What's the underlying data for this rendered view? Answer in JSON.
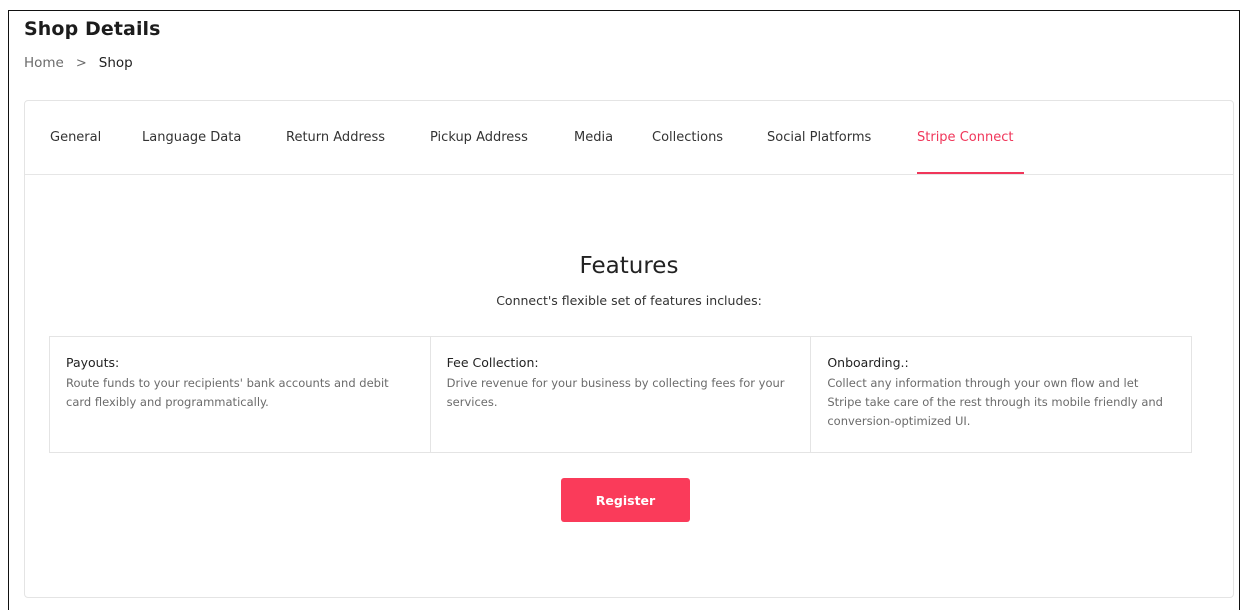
{
  "page": {
    "title": "Shop Details",
    "breadcrumb": {
      "home": "Home",
      "separator": ">",
      "current": "Shop"
    }
  },
  "tabs": [
    {
      "label": "General",
      "active": false
    },
    {
      "label": "Language Data",
      "active": false
    },
    {
      "label": "Return Address",
      "active": false
    },
    {
      "label": "Pickup Address",
      "active": false
    },
    {
      "label": "Media",
      "active": false
    },
    {
      "label": "Collections",
      "active": false
    },
    {
      "label": "Social Platforms",
      "active": false
    },
    {
      "label": "Stripe Connect",
      "active": true
    }
  ],
  "features": {
    "title": "Features",
    "subtitle": "Connect's flexible set of features includes:",
    "items": [
      {
        "title": "Payouts:",
        "description": "Route funds to your recipients' bank accounts and debit card flexibly and programmatically."
      },
      {
        "title": "Fee Collection:",
        "description": "Drive revenue for your business by collecting fees for your services."
      },
      {
        "title": "Onboarding.:",
        "description": "Collect any information through your own flow and let Stripe take care of the rest through its mobile friendly and conversion-optimized UI."
      }
    ]
  },
  "actions": {
    "register_label": "Register"
  },
  "colors": {
    "accent": "#f0365a",
    "button": "#fa3b5a"
  }
}
